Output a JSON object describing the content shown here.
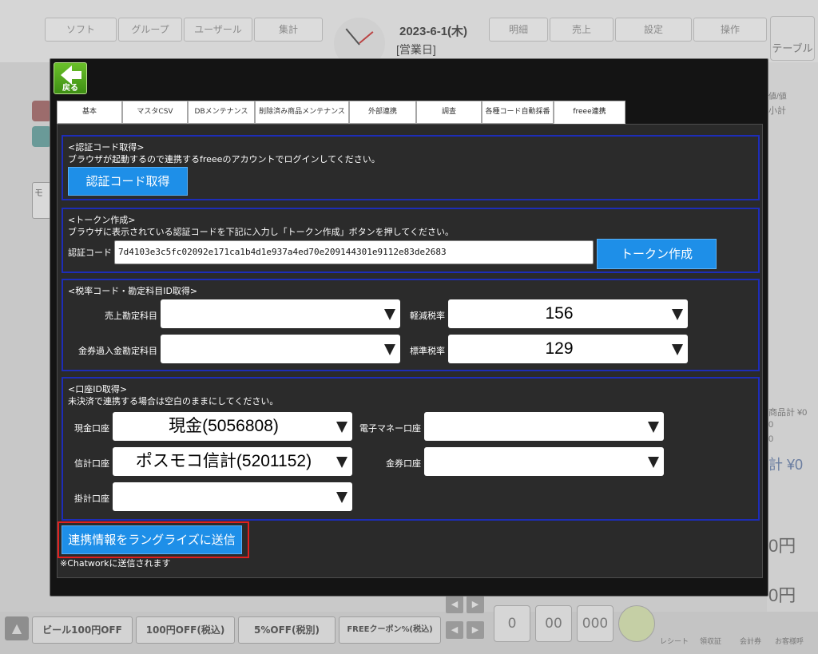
{
  "background": {
    "top_buttons": [
      "ソフト",
      "グループ",
      "ユーザール",
      "集計",
      "明細",
      "売上",
      "設定",
      "操作"
    ],
    "date": "2023-6-1(木)",
    "day_type": "[営業日]",
    "table_label": "テーブル",
    "right_texts": [
      "値/値",
      "小計",
      "商品計 ¥0",
      "0",
      "0",
      "計 ¥0",
      "0円",
      "0円"
    ],
    "left_label": "モ",
    "bottom_buttons": [
      "ビール100円OFF",
      "100円OFF(税込)",
      "5%OFF(税別)",
      "FREEクーポン%(税込)"
    ],
    "numpad": [
      "0",
      "00",
      "000"
    ],
    "bottom_icons": [
      "レシート",
      "領収証",
      "会計券",
      "お客様呼"
    ]
  },
  "modal": {
    "back_label": "戻る",
    "tabs": [
      "基本",
      "マスタCSV",
      "DBメンテナンス",
      "削除済み商品メンテナンス",
      "外部連携",
      "調査",
      "各種コード自動採番",
      "freee連携"
    ],
    "active_tab": "freee連携",
    "auth_section": {
      "title": "<認証コード取得>",
      "description": "ブラウザが起動するので連携するfreeeのアカウントでログインしてください。",
      "button_label": "認証コード取得"
    },
    "token_section": {
      "title": "<トークン作成>",
      "description": "ブラウザに表示されている認証コードを下記に入力し「トークン作成」ボタンを押してください。",
      "code_label": "認証コード",
      "code_value": "7d4103e3c5fc02092e171ca1b4d1e937a4ed70e209144301e9112e83de2683",
      "button_label": "トークン作成"
    },
    "tax_section": {
      "title": "<税率コード・勘定科目ID取得>",
      "sales_account_label": "売上勘定科目",
      "sales_account_value": "",
      "reduced_tax_label": "軽減税率",
      "reduced_tax_value": "156",
      "voucher_over_label": "金券過入金勘定科目",
      "voucher_over_value": "",
      "standard_tax_label": "標準税率",
      "standard_tax_value": "129"
    },
    "account_section": {
      "title": "<口座ID取得>",
      "description": "未決済で連携する場合は空白のままにしてください。",
      "cash_label": "現金口座",
      "cash_value": "現金(5056808)",
      "emoney_label": "電子マネー口座",
      "emoney_value": "",
      "credit_label": "信計口座",
      "credit_value": "ポスモコ信計(5201152)",
      "voucher_label": "金券口座",
      "voucher_value": "",
      "receivable_label": "掛計口座",
      "receivable_value": ""
    },
    "send_button_label": "連携情報をラングライズに送信",
    "send_note": "※Chatworkに送信されます",
    "colors": {
      "accent_blue": "#1e8fe8",
      "section_border": "#1d2db8",
      "highlight_red": "#e0201f"
    }
  }
}
